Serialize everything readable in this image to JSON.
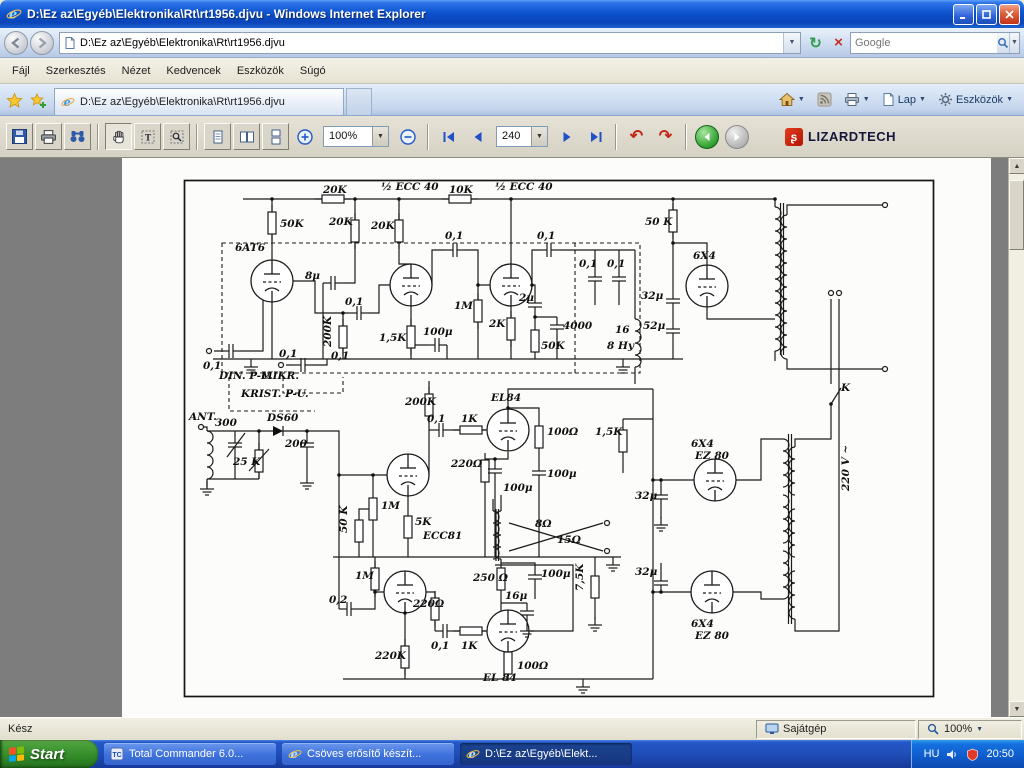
{
  "titlebar": {
    "title": "D:\\Ez az\\Egyéb\\Elektronika\\Rt\\rt1956.djvu - Windows Internet Explorer"
  },
  "address_bar": {
    "url": "D:\\Ez az\\Egyéb\\Elektronika\\Rt\\rt1956.djvu",
    "search_placeholder": "Google"
  },
  "menu_bar": {
    "items": [
      "Fájl",
      "Szerkesztés",
      "Nézet",
      "Kedvencek",
      "Eszközök",
      "Súgó"
    ]
  },
  "tab_bar": {
    "tab_title": "D:\\Ez az\\Egyéb\\Elektronika\\Rt\\rt1956.djvu",
    "lap": "Lap",
    "eszkozok": "Eszközök"
  },
  "viewer_toolbar": {
    "zoom": "100%",
    "page": "240",
    "logo": "LIZARDTECH"
  },
  "status_bar": {
    "left": "Kész",
    "zone": "Sajátgép",
    "zoom": "100%"
  },
  "taskbar": {
    "start": "Start",
    "tasks": [
      "Total Commander 6.0...",
      "Csöves erősítő készít...",
      "D:\\Ez az\\Egyéb\\Elekt..."
    ],
    "lang": "HU",
    "clock": "20:50"
  },
  "schematic": {
    "labels": [
      "20K",
      "½ ECC 40",
      "10K",
      "½ ECC 40",
      "50K",
      "20K",
      "20K",
      "0,1",
      "0,1",
      "6AT6",
      "8μ",
      "0,1",
      "0,1",
      "50 K",
      "6X4",
      "32μ",
      "52μ",
      "200K",
      "0,1",
      "1M",
      "2K",
      "1,5K",
      "100μ",
      "2μ",
      "4000",
      "50K",
      "16",
      "8 Hy",
      "0,1",
      "DIN. P-U.",
      "MIKR.",
      "0,1",
      "0,1",
      "KRIST. P-U.",
      "ANT.",
      "300",
      "DS60",
      "25 K",
      "200",
      "200K",
      "0,1",
      "1K",
      "EL84",
      "100Ω",
      "220Ω",
      "100μ",
      "1,5K",
      "100μ",
      "1M",
      "50 K",
      "5K",
      "ECC81",
      "8Ω",
      "15Ω",
      "1M",
      "250 Ω",
      "100μ",
      "16μ",
      "7,5K",
      "0,2",
      "220Ω",
      "0,1",
      "1K",
      "220K",
      "100Ω",
      "EL 84",
      "32μ",
      "32μ",
      "6X4",
      "EZ 80",
      "6X4",
      "EZ 80",
      "220 V ~",
      "K"
    ]
  }
}
